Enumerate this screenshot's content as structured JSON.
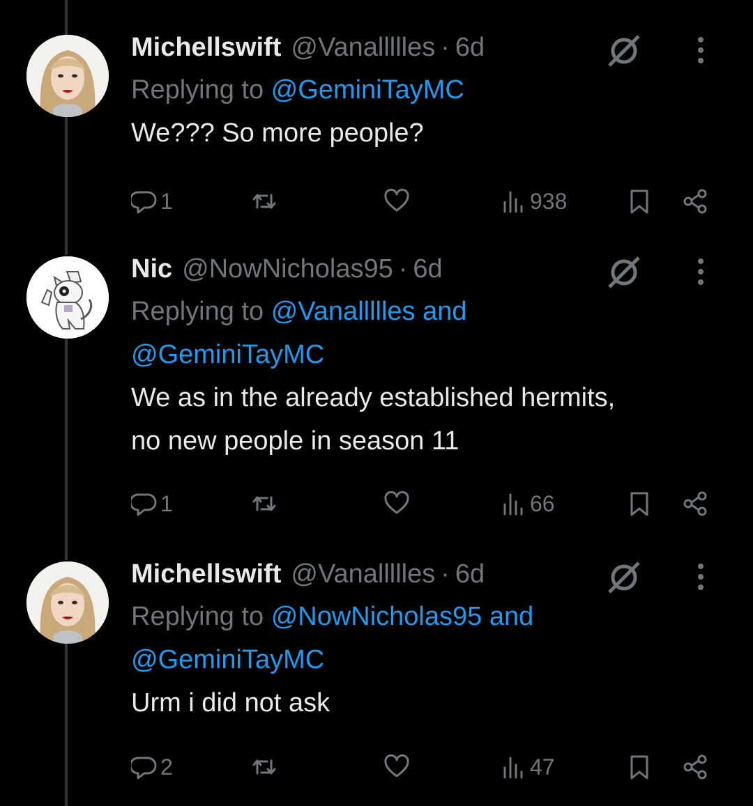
{
  "tweets": [
    {
      "display_name": "Michellswift",
      "handle": "@Vanallllles",
      "separator": "·",
      "time": "6d",
      "replying_prefix": "Replying to",
      "reply_line1": "@GeminiTayMC",
      "reply_line2": "",
      "text_line1": "We??? So more people?",
      "text_line2": "",
      "replies": "1",
      "views": "938",
      "avatar_icon": "photo-avatar"
    },
    {
      "display_name": "Nic",
      "handle": "@NowNicholas95",
      "separator": "·",
      "time": "6d",
      "replying_prefix": "Replying to",
      "reply_line1": "@Vanallllles and",
      "reply_line2": "@GeminiTayMC",
      "text_line1": "We as in the already established hermits,",
      "text_line2": "no new people in season 11",
      "replies": "1",
      "views": "66",
      "avatar_icon": "cartoon-cat-avatar"
    },
    {
      "display_name": "Michellswift",
      "handle": "@Vanallllles",
      "separator": "·",
      "time": "6d",
      "replying_prefix": "Replying to",
      "reply_line1": "@NowNicholas95 and",
      "reply_line2": "@GeminiTayMC",
      "text_line1": "Urm i did not ask",
      "text_line2": "",
      "replies": "2",
      "views": "47",
      "avatar_icon": "photo-avatar"
    }
  ],
  "colors": {
    "background": "#000000",
    "text": "#e7e9ea",
    "muted": "#71767b",
    "link": "#1d9bf0",
    "thread_line": "#333639"
  }
}
